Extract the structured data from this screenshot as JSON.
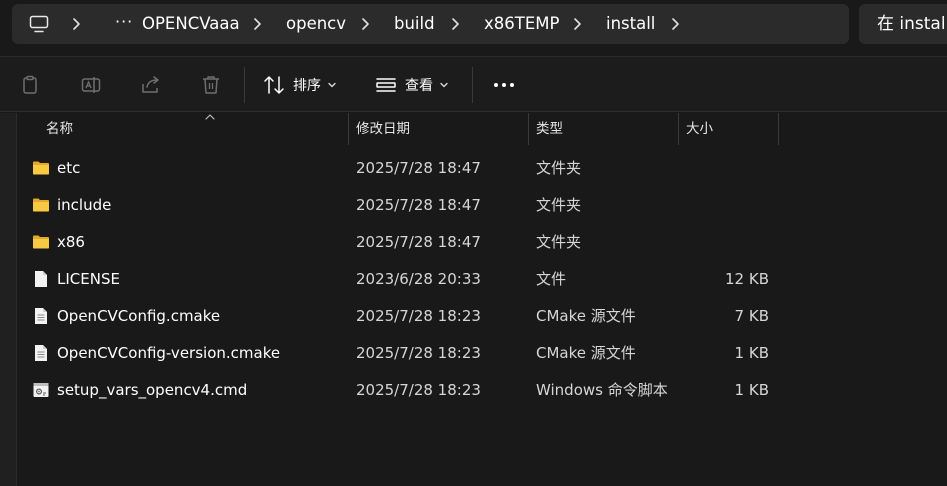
{
  "address_bar": {
    "root_icon": "this-pc-icon",
    "ellipsis": "···",
    "breadcrumbs": [
      "OPENCVaaa",
      "opencv",
      "build",
      "x86TEMP",
      "install"
    ]
  },
  "search": {
    "placeholder_text": "在 install"
  },
  "toolbar": {
    "icons": [
      "copy-icon",
      "rename-icon",
      "share-icon",
      "delete-icon"
    ],
    "sort_label": "排序",
    "view_label": "查看",
    "more_label": "···"
  },
  "columns": {
    "name": "名称",
    "date": "修改日期",
    "type": "类型",
    "size": "大小"
  },
  "files": [
    {
      "icon": "folder-icon",
      "name": "etc",
      "date": "2025/7/28 18:47",
      "type": "文件夹",
      "size": ""
    },
    {
      "icon": "folder-icon",
      "name": "include",
      "date": "2025/7/28 18:47",
      "type": "文件夹",
      "size": ""
    },
    {
      "icon": "folder-icon",
      "name": "x86",
      "date": "2025/7/28 18:47",
      "type": "文件夹",
      "size": ""
    },
    {
      "icon": "blank-file-icon",
      "name": "LICENSE",
      "date": "2023/6/28 20:33",
      "type": "文件",
      "size": "12 KB"
    },
    {
      "icon": "text-file-icon",
      "name": "OpenCVConfig.cmake",
      "date": "2025/7/28 18:23",
      "type": "CMake 源文件",
      "size": "7 KB"
    },
    {
      "icon": "text-file-icon",
      "name": "OpenCVConfig-version.cmake",
      "date": "2025/7/28 18:23",
      "type": "CMake 源文件",
      "size": "1 KB"
    },
    {
      "icon": "script-file-icon",
      "name": "setup_vars_opencv4.cmd",
      "date": "2025/7/28 18:23",
      "type": "Windows 命令脚本",
      "size": "1 KB"
    }
  ],
  "colors": {
    "background": "#191919",
    "bar": "#2b2b2b",
    "folder": "#f3c13a",
    "text": "#ffffff"
  }
}
